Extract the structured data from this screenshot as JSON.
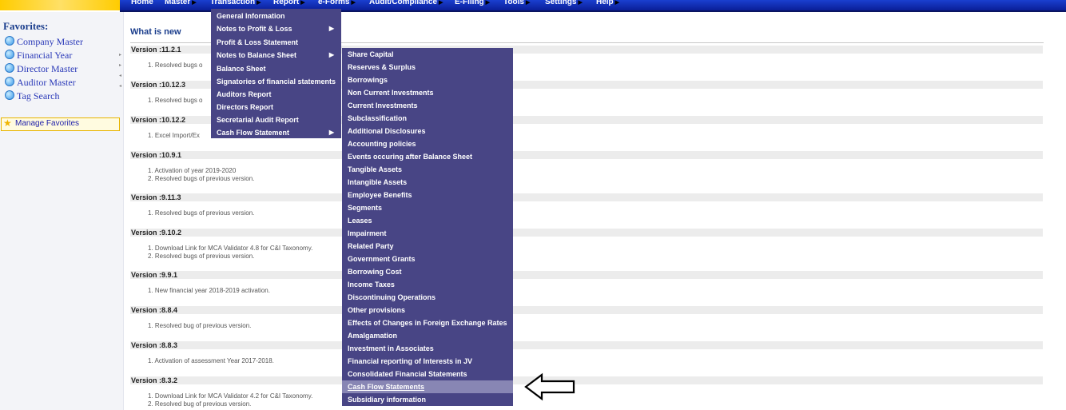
{
  "topnav": {
    "items": [
      {
        "label": "Home",
        "arrow": false
      },
      {
        "label": "Master",
        "arrow": true
      },
      {
        "label": "Transaction",
        "arrow": true
      },
      {
        "label": "Report",
        "arrow": true
      },
      {
        "label": "e-Forms",
        "arrow": true
      },
      {
        "label": "Audit/Compliance",
        "arrow": true
      },
      {
        "label": "E-Filing",
        "arrow": true
      },
      {
        "label": "Tools",
        "arrow": true
      },
      {
        "label": "Settings",
        "arrow": true
      },
      {
        "label": "Help",
        "arrow": true
      }
    ],
    "submenu_arrow": "▶"
  },
  "sidebar": {
    "title": "Favorites:",
    "items": [
      "Company Master",
      "Financial Year",
      "Director Master",
      "Auditor Master",
      "Tag Search"
    ],
    "manage_label": "Manage Favorites",
    "star_icon": "★"
  },
  "main": {
    "title": "What is new",
    "versions": [
      {
        "version": "Version :11.2.1",
        "lines": [
          "1. Resolved bugs o"
        ]
      },
      {
        "version": "Version :10.12.3",
        "lines": [
          "1. Resolved bugs o"
        ]
      },
      {
        "version": "Version :10.12.2",
        "lines": [
          "1. Excel Import/Ex"
        ]
      },
      {
        "version": "Version :10.9.1",
        "lines": [
          "1. Activation of year 2019-2020",
          "2. Resolved bugs of previous version."
        ]
      },
      {
        "version": "Version :9.11.3",
        "lines": [
          "1. Resolved bugs of previous version."
        ]
      },
      {
        "version": "Version :9.10.2",
        "lines": [
          "1. Download Link for MCA Validator 4.8 for C&I Taxonomy.",
          "2. Resolved bugs of previous version."
        ]
      },
      {
        "version": "Version :9.9.1",
        "lines": [
          "1. New financial year 2018-2019 activation."
        ]
      },
      {
        "version": "Version :8.8.4",
        "lines": [
          "1. Resolved bug of previous version."
        ]
      },
      {
        "version": "Version :8.8.3",
        "lines": [
          "1. Activation of assessment Year 2017-2018."
        ]
      },
      {
        "version": "Version :8.3.2",
        "lines": [
          "1. Download Link for MCA Validator 4.2 for C&I Taxonomy.",
          "2. Resolved bug of previous version."
        ]
      }
    ]
  },
  "report_menu": {
    "items": [
      {
        "label": "General Information",
        "has_sub": false
      },
      {
        "label": "Notes to Profit & Loss",
        "has_sub": true
      },
      {
        "label": "Profit & Loss Statement",
        "has_sub": false
      },
      {
        "label": "Notes to Balance Sheet",
        "has_sub": true
      },
      {
        "label": "Balance Sheet",
        "has_sub": false
      },
      {
        "label": "Signatories of financial statements",
        "has_sub": false
      },
      {
        "label": "Auditors Report",
        "has_sub": false
      },
      {
        "label": "Directors Report",
        "has_sub": false
      },
      {
        "label": "Secretarial Audit Report",
        "has_sub": false
      },
      {
        "label": "Cash Flow Statement",
        "has_sub": true
      }
    ]
  },
  "balance_sheet_submenu": {
    "highlighted_index": 26,
    "items": [
      "Share Capital",
      "Reserves & Surplus",
      "Borrowings",
      "Non Current Investments",
      "Current Investments",
      "Subclassification",
      "Additional Disclosures",
      "Accounting policies",
      "Events occuring after Balance Sheet",
      "Tangible Assets",
      "Intangible Assets",
      "Employee Benefits",
      "Segments",
      "Leases",
      "Impairment",
      "Related Party",
      "Government Grants",
      "Borrowing Cost",
      "Income Taxes",
      "Discontinuing Operations",
      "Other provisions",
      "Effects of Changes in Foreign Exchange Rates",
      "Amalgamation",
      "Investment in Associates",
      "Financial reporting of Interests in JV",
      "Consolidated Financial Statements",
      "Cash Flow Statements",
      "Subsidiary information"
    ]
  },
  "colors": {
    "menu_bg": "#484585",
    "menu_highlight": "#8886b4",
    "topbar": "#0a1e98"
  }
}
